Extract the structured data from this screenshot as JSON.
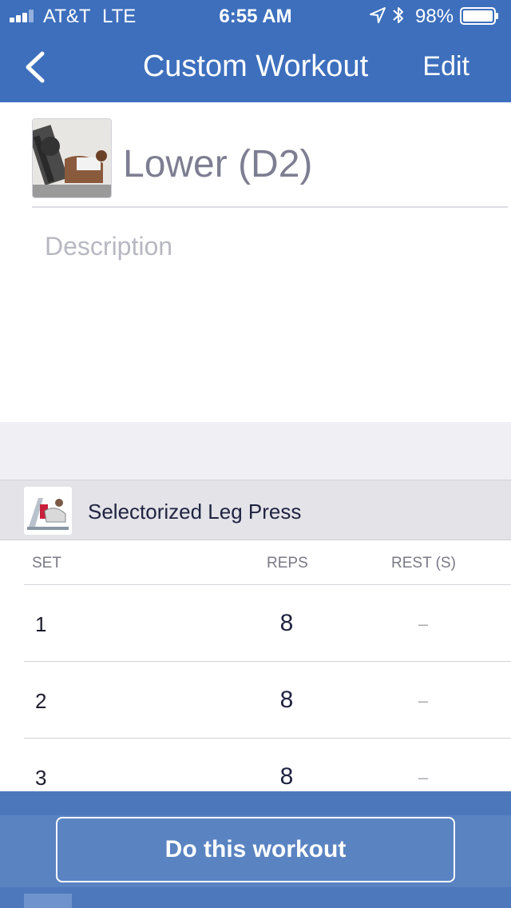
{
  "status_bar": {
    "carrier": "AT&T",
    "network": "LTE",
    "time": "6:55 AM",
    "battery": "98%",
    "battery_level": 0.98,
    "icons": [
      "signal-icon",
      "location-icon",
      "bluetooth-icon",
      "battery-icon"
    ]
  },
  "nav": {
    "back_icon": "chevron-left-icon",
    "title": "Custom Workout",
    "edit_label": "Edit"
  },
  "workout": {
    "name": "Lower (D2)",
    "description_placeholder": "Description"
  },
  "exercise": {
    "name": "Selectorized Leg Press",
    "columns": {
      "set": "SET",
      "reps": "REPS",
      "rest": "REST (S)"
    },
    "sets": [
      {
        "set": "1",
        "reps": "8",
        "rest": "–"
      },
      {
        "set": "2",
        "reps": "8",
        "rest": "–"
      },
      {
        "set": "3",
        "reps": "8",
        "rest": "–"
      }
    ]
  },
  "footer": {
    "cta_label": "Do this workout"
  },
  "colors": {
    "header_blue": "#3d6fbd",
    "footer_blue": "#5a83c2",
    "section_gray": "#efeff4"
  }
}
